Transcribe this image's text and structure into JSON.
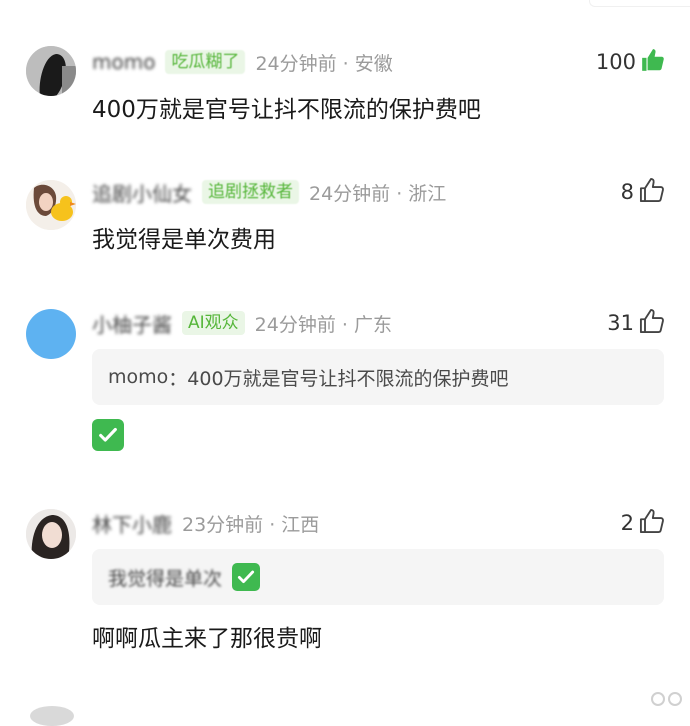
{
  "comments": [
    {
      "username": "momo",
      "badge": "吃瓜糊了",
      "meta": "24分钟前 · 安徽",
      "likes": "100",
      "liked": true,
      "text": "400万就是官号让抖不限流的保护费吧"
    },
    {
      "username": "追剧小仙女",
      "badge": "追剧拯救者",
      "meta": "24分钟前 · 浙江",
      "likes": "8",
      "liked": false,
      "text": "我觉得是单次费用"
    },
    {
      "username": "小柚子酱",
      "badge": "AI观众",
      "meta": "24分钟前 · 广东",
      "likes": "31",
      "liked": false,
      "quote": {
        "author": "momo",
        "separator": "：",
        "text": "400万就是官号让抖不限流的保护费吧"
      },
      "reply_emoji": "check-mark-button"
    },
    {
      "username": "林下小鹿",
      "meta": "23分钟前 · 江西",
      "likes": "2",
      "liked": false,
      "quote": {
        "author": "我觉得是单次",
        "emoji": "check-mark-button"
      },
      "text": "啊啊瓜主来了那很贵啊"
    }
  ],
  "colors": {
    "badge_bg": "#eaf6e6",
    "badge_text": "#56b63a",
    "liked": "#3fb950",
    "meta": "#9b9b9b",
    "check_green": "#3fb950"
  },
  "icons": [
    "thumbs-up-icon",
    "check-mark-button-icon"
  ]
}
